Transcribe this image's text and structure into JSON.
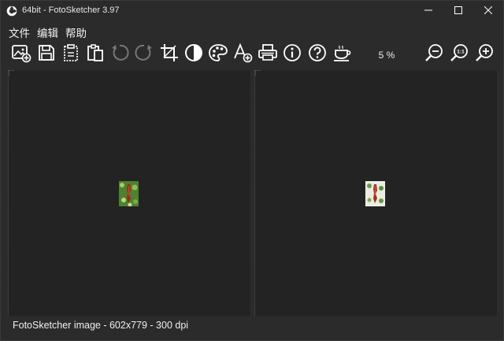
{
  "window": {
    "title": "64bit - FotoSketcher 3.97",
    "minimize_icon": "minimize-icon",
    "maximize_icon": "maximize-icon",
    "close_icon": "close-icon"
  },
  "menu": {
    "items": [
      "文件",
      "编辑",
      "帮助"
    ]
  },
  "toolbar": {
    "icons": [
      "open-image-icon",
      "save-icon",
      "paste-icon",
      "copy-icon",
      "undo-icon",
      "redo-icon",
      "crop-icon",
      "contrast-icon",
      "palette-icon",
      "add-text-icon",
      "print-icon",
      "info-icon",
      "help-icon",
      "coffee-icon"
    ],
    "zoom_level": "5 %",
    "zoom_out_icon": "zoom-out-icon",
    "zoom_actual_icon": "zoom-actual-icon",
    "zoom_in_icon": "zoom-in-icon",
    "zoom_actual_label": "1:1"
  },
  "status": {
    "text": "FotoSketcher image - 602x779 - 300 dpi"
  },
  "colors": {
    "background": "#2b2b2b",
    "pane": "#232323",
    "text": "#ffffff"
  }
}
